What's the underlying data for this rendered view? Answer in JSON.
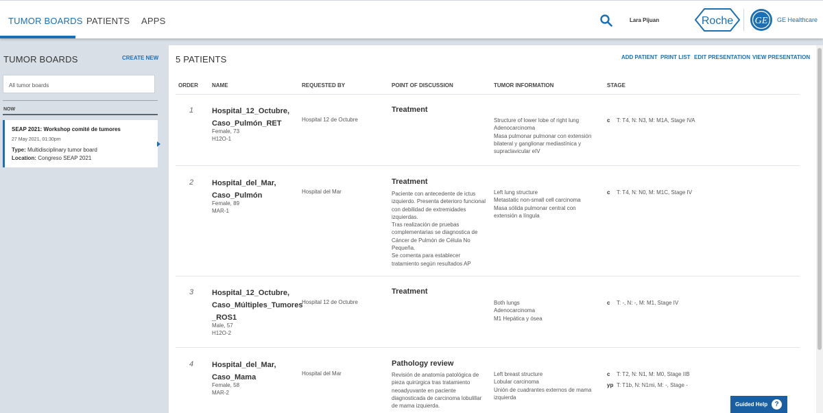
{
  "nav": {
    "items": [
      "TUMOR BOARDS",
      "PATIENTS",
      "APPS"
    ],
    "user_name": "Lara Pijuan",
    "roche_logo_text": "Roche",
    "ge_logo_text": "GE",
    "ge_label": "GE Healthcare"
  },
  "sidebar": {
    "title": "TUMOR BOARDS",
    "create_new": "CREATE NEW",
    "filter_value": "All tumor boards",
    "now_label": "NOW",
    "board": {
      "title": "SEAP 2021: Workshop comité de tumores",
      "date": "27 May 2021, 01:30pm",
      "type_label": "Type:",
      "type_value": "Multidisciplinary tumor board",
      "location_label": "Location:",
      "location_value": "Congreso SEAP 2021"
    }
  },
  "main": {
    "patients_count": "5 PATIENTS",
    "actions": [
      "ADD PATIENT",
      "PRINT LIST",
      "EDIT PRESENTATION",
      "VIEW PRESENTATION"
    ],
    "columns": [
      "ORDER",
      "NAME",
      "REQUESTED BY",
      "POINT OF DISCUSSION",
      "TUMOR INFORMATION",
      "STAGE"
    ],
    "patients": [
      {
        "order": "1",
        "name_lines": [
          "Hospital_12_Octubre,",
          "Caso_Pulmón_RET"
        ],
        "gender_age": "Female, 73",
        "id": "H12O-1",
        "requested_by": "Hospital 12 de Octubre",
        "pod_title": "Treatment",
        "pod_text": [],
        "tumor": [
          "Structure of lower lobe of right lung",
          "Adenocarcinoma",
          "Masa pulmonar pulmonar con extensión bilateral y ganglionar mediastínica y supraclavicular eIV"
        ],
        "stages": [
          {
            "prefix": "c",
            "text": "T: T4, N: N3, M: M1A, Stage IVA"
          }
        ]
      },
      {
        "order": "2",
        "name_lines": [
          "Hospital_del_Mar,",
          "Caso_Pulmón"
        ],
        "gender_age": "Female, 89",
        "id": "MAR-1",
        "requested_by": "Hospital del Mar",
        "pod_title": "Treatment",
        "pod_text": [
          "Paciente con antecedente de ictus izquierdo. Presenta  deterioro funcional con debilidad de extremidades izquierdas.",
          "Tras realización de pruebas complementarias se diagnostica de Cáncer de Pulmón de Célula No Pequeña.",
          "Se comenta para establecer tratamiento según resultados AP"
        ],
        "tumor": [
          "Left lung structure",
          "Metastatic non-small cell carcinoma",
          "Masa sólida pulmonar central con extensión a língula"
        ],
        "stages": [
          {
            "prefix": "c",
            "text": "T: T4, N: N0, M: M1C, Stage IV"
          }
        ]
      },
      {
        "order": "3",
        "name_lines": [
          "Hospital_12_Octubre,",
          "Caso_Múltiples_Tumores",
          "_ROS1"
        ],
        "gender_age": "Male, 57",
        "id": "H12O-2",
        "requested_by": "Hospital 12 de Octubre",
        "pod_title": "Treatment",
        "pod_text": [],
        "tumor": [
          "Both lungs",
          "Adenocarcinoma",
          "M1 Hepática y ósea"
        ],
        "stages": [
          {
            "prefix": "c",
            "text": "T: -, N: -, M: M1, Stage IV"
          }
        ]
      },
      {
        "order": "4",
        "name_lines": [
          "Hospital_del_Mar,",
          "Caso_Mama"
        ],
        "gender_age": "Female, 58",
        "id": "MAR-2",
        "requested_by": "Hospital del Mar",
        "pod_title": "Pathology review",
        "pod_text": [
          "Revisión de anatomía patológica de pieza quirúrgica tras tratamiento neoadyuvante en paciente diagnosticada de carcinoma lobulillar de mama izquierda."
        ],
        "tumor": [
          "Left breast structure",
          "Lobular carcinoma",
          "Unión de cuadrantes externos de mama izquierda"
        ],
        "stages": [
          {
            "prefix": "c",
            "text": "T: T2, N: N1, M: M0, Stage IIB"
          },
          {
            "prefix": "yp",
            "text": "T: T1b, N: N1mi, M: -, Stage -"
          }
        ]
      }
    ]
  },
  "guided_help": {
    "label": "Guided Help",
    "icon": "?"
  },
  "colors": {
    "accent": "#1b6fb5",
    "background": "#d9dfe6"
  }
}
